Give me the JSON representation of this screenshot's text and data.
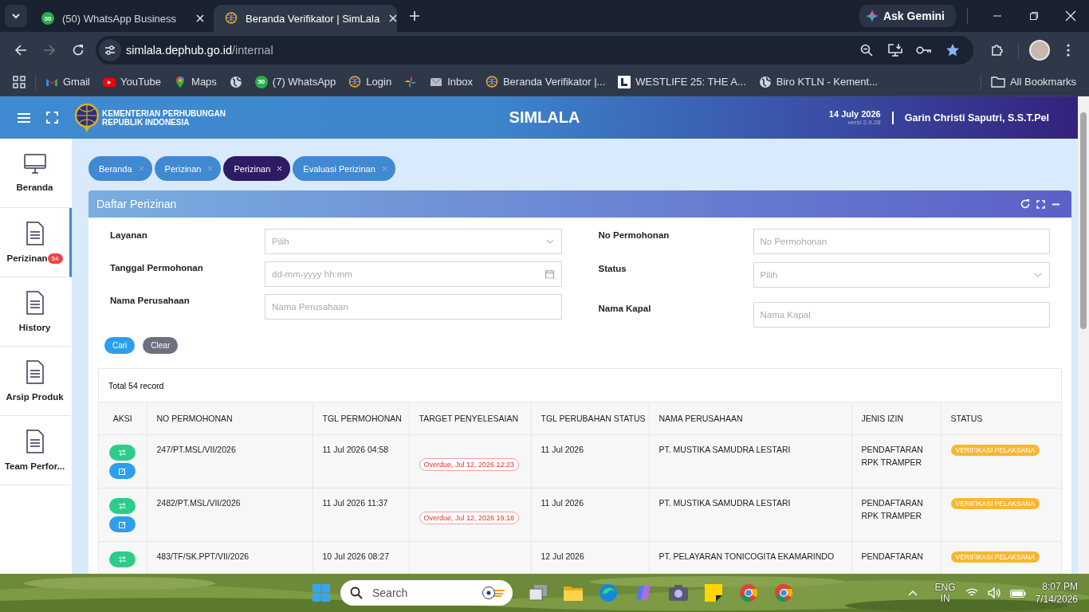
{
  "browser": {
    "tabs": [
      {
        "title": "(50) WhatsApp Business",
        "icon_text": "50",
        "selected": false
      },
      {
        "title": "Beranda Verifikator | SimLala",
        "selected": true
      }
    ],
    "ask_button": "Ask Gemini",
    "address": {
      "host": "simlala.dephub.go.id",
      "path": "/internal"
    },
    "bookmarks": [
      {
        "kind": "link",
        "label": "Gmail"
      },
      {
        "kind": "link",
        "label": "YouTube"
      },
      {
        "kind": "link",
        "label": "Maps"
      },
      {
        "kind": "icon"
      },
      {
        "kind": "link",
        "icon_text": "50",
        "label": "(7) WhatsApp"
      },
      {
        "kind": "link",
        "label": "Login"
      },
      {
        "kind": "icon"
      },
      {
        "kind": "link",
        "label": "Inbox"
      },
      {
        "kind": "link",
        "label": "Beranda Verifikator |..."
      },
      {
        "kind": "link",
        "label": "WESTLIFE 25: THE A..."
      },
      {
        "kind": "link",
        "label": "Biro KTLN - Kement..."
      }
    ],
    "all_bookmarks": "All Bookmarks"
  },
  "header": {
    "org_line_1": "KEMENTERIAN PERHUBUNGAN",
    "org_line_2": "REPUBLIK INDONESIA",
    "app_title": "SIMLALA",
    "date": "14 July 2026",
    "version": "versi 2.0.28",
    "user": "Garin Christi Saputri, S.S.T.Pel"
  },
  "sidebar": {
    "items": [
      {
        "kind": "monitor",
        "label": "Beranda",
        "selected": false
      },
      {
        "kind": "document",
        "label": "Perizinan",
        "badge": "54",
        "selected": true
      },
      {
        "kind": "document",
        "label": "History",
        "selected": false
      },
      {
        "kind": "document",
        "label": "Arsip Produk",
        "selected": false
      },
      {
        "kind": "document",
        "label": "Team Perfor...",
        "selected": false
      }
    ]
  },
  "page_tabs": [
    {
      "label": "Beranda",
      "selected": false
    },
    {
      "label": "Perizinan",
      "selected": false
    },
    {
      "label": "Perizinan",
      "selected": true
    },
    {
      "label": "Evaluasi Perizinan",
      "selected": false
    }
  ],
  "panel": {
    "title": "Daftar Perizinan",
    "filters_left": [
      {
        "label": "Layanan",
        "kind": "select",
        "placeholder": "Pilih"
      },
      {
        "label": "Tanggal Permohonan",
        "kind": "date",
        "placeholder": "dd-mm-yyyy hh:mm"
      },
      {
        "label": "Nama Perusahaan",
        "kind": "text",
        "placeholder": "Nama Perusahaan"
      }
    ],
    "filters_right": [
      {
        "label": "No Permohonan",
        "kind": "text",
        "placeholder": "No Permohonan"
      },
      {
        "label": "Status",
        "kind": "select",
        "placeholder": "Pilih"
      },
      {
        "label": "Nama Kapal",
        "kind": "text",
        "placeholder": "Nama Kapal"
      }
    ],
    "buttons": [
      {
        "label": "Cari",
        "kind": "primary"
      },
      {
        "label": "Clear",
        "kind": "secondary"
      }
    ]
  },
  "table": {
    "total": "Total 54 record",
    "columns": [
      "AKSI",
      "NO PERMOHONAN",
      "TGL PERMOHONAN",
      "TARGET PENYELESAIAN",
      "TGL PERUBAHAN STATUS",
      "NAMA PERUSAHAAN",
      "JENIS IZIN",
      "STATUS"
    ],
    "rows": [
      {
        "no": "247/PT.MSL/VII/2026",
        "date": "11 Jul 2026 04:58",
        "target": "Overdue, Jul 12, 2026 12:23",
        "changed": "11 Jul 2026",
        "company": "PT. MUSTIKA SAMUDRA LESTARI",
        "permit": "PENDAFTARAN RPK TRAMPER",
        "status": "VERIFIKASI PELAKSANA"
      },
      {
        "no": "2482/PT.MSL/VII/2026",
        "date": "11 Jul 2026 11:37",
        "target": "Overdue, Jul 12, 2026 19:18",
        "changed": "11 Jul 2026",
        "company": "PT. MUSTIKA SAMUDRA LESTARI",
        "permit": "PENDAFTARAN RPK TRAMPER",
        "status": "VERIFIKASI PELAKSANA"
      },
      {
        "no": "483/TF/SK.PPT/VII/2026",
        "date": "10 Jul 2026 08:27",
        "changed": "12 Jul 2026",
        "company": "PT. PELAYARAN TONICOGITA EKAMARINDO",
        "permit": "PENDAFTARAN",
        "status": "VERIFIKASI PELAKSANA"
      }
    ]
  },
  "taskbar": {
    "search_placeholder": "Search",
    "language": "ENG",
    "region": "IN",
    "time": "8:07 PM",
    "date": "7/14/2026"
  }
}
